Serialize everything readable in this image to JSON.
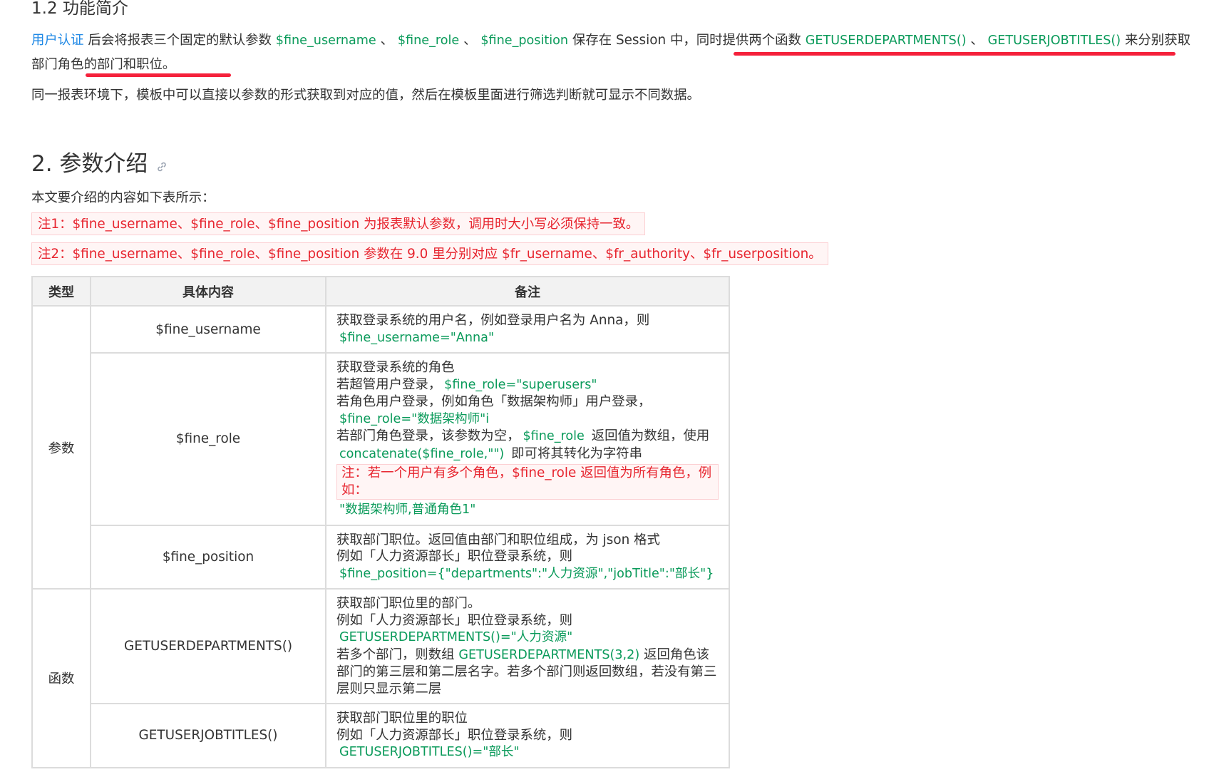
{
  "section_12_title": "1.2 功能简介",
  "para1": {
    "link": "用户认证",
    "t1": " 后会将报表三个固定的默认参数 ",
    "c1": "$fine_username",
    "t2": " 、 ",
    "c2": "$fine_role",
    "t3": " 、 ",
    "c3": "$fine_position",
    "t4": " 保存在 Session 中，同时提供两个函数 ",
    "c4": "GETUSERDEPARTMENTS()",
    "t5": " 、 ",
    "c5": "GETUSERJOBTITLES()",
    "t6": " 来分别获取",
    "line2": "部门角色的部门和职位。"
  },
  "para2": "同一报表环境下，模板中可以直接以参数的形式获取到对应的值，然后在模板里面进行筛选判断就可显示不同数据。",
  "section2_title": "2. 参数介绍",
  "intro": "本文要介绍的内容如下表所示：",
  "note1": "注1：$fine_username、$fine_role、$fine_position 为报表默认参数，调用时大小写必须保持一致。",
  "note2": "注2：$fine_username、$fine_role、$fine_position 参数在 9.0 里分别对应 $fr_username、$fr_authority、$fr_userposition。",
  "table": {
    "headers": [
      "类型",
      "具体内容",
      "备注"
    ],
    "type_param": "参数",
    "type_func": "函数",
    "rows": {
      "username": {
        "item": "$fine_username",
        "l1": "获取登录系统的用户名，例如登录用户名为 Anna，则",
        "c1": "$fine_username=\"Anna\""
      },
      "role": {
        "item": "$fine_role",
        "l1": "获取登录系统的角色",
        "l2": "若超管用户登录，",
        "c2": "$fine_role=\"superusers\"",
        "l3": "若角色用户登录，例如角色「数据架构师」用户登录，",
        "c3": "$fine_role=\"数据架构师\"i",
        "l4a": "若部门角色登录，该参数为空，",
        "c4": "$fine_role",
        "l4b": " 返回值为数组，使用",
        "c5": "concatenate($fine_role,\"\")",
        "l5": " 即可将其转化为字符串",
        "note": "注：若一个用户有多个角色，$fine_role 返回值为所有角色，例如：",
        "c6": "\"数据架构师,普通角色1\""
      },
      "position": {
        "item": "$fine_position",
        "l1": "获取部门职位。返回值由部门和职位组成，为 json 格式",
        "l2": "例如「人力资源部长」职位登录系统，则",
        "c1": "$fine_position={\"departments\":\"人力资源\",\"jobTitle\":\"部长\"}"
      },
      "departments": {
        "item": "GETUSERDEPARTMENTS()",
        "l1": "获取部门职位里的部门。",
        "l2": "例如「人力资源部长」职位登录系统，则",
        "c1": "GETUSERDEPARTMENTS()=\"人力资源\"",
        "l3a": "若多个部门，则数组 ",
        "c2": "GETUSERDEPARTMENTS(3,2)",
        "l3b": " 返回角色该部门的第三层和第二层名字。若多个部门则返回数组，若没有第三层则只显示第二层"
      },
      "jobtitles": {
        "item": "GETUSERJOBTITLES()",
        "l1": "获取部门职位里的职位",
        "l2": "例如「人力资源部长」职位登录系统，则",
        "c1": "GETUSERJOBTITLES()=\"部长\""
      }
    }
  },
  "colors": {
    "link": "#1e88e5",
    "code": "#0a9a5a",
    "note_red": "#e7252f",
    "underline": "#f5213b"
  },
  "icons": {
    "anchor": "link-chain-icon"
  }
}
